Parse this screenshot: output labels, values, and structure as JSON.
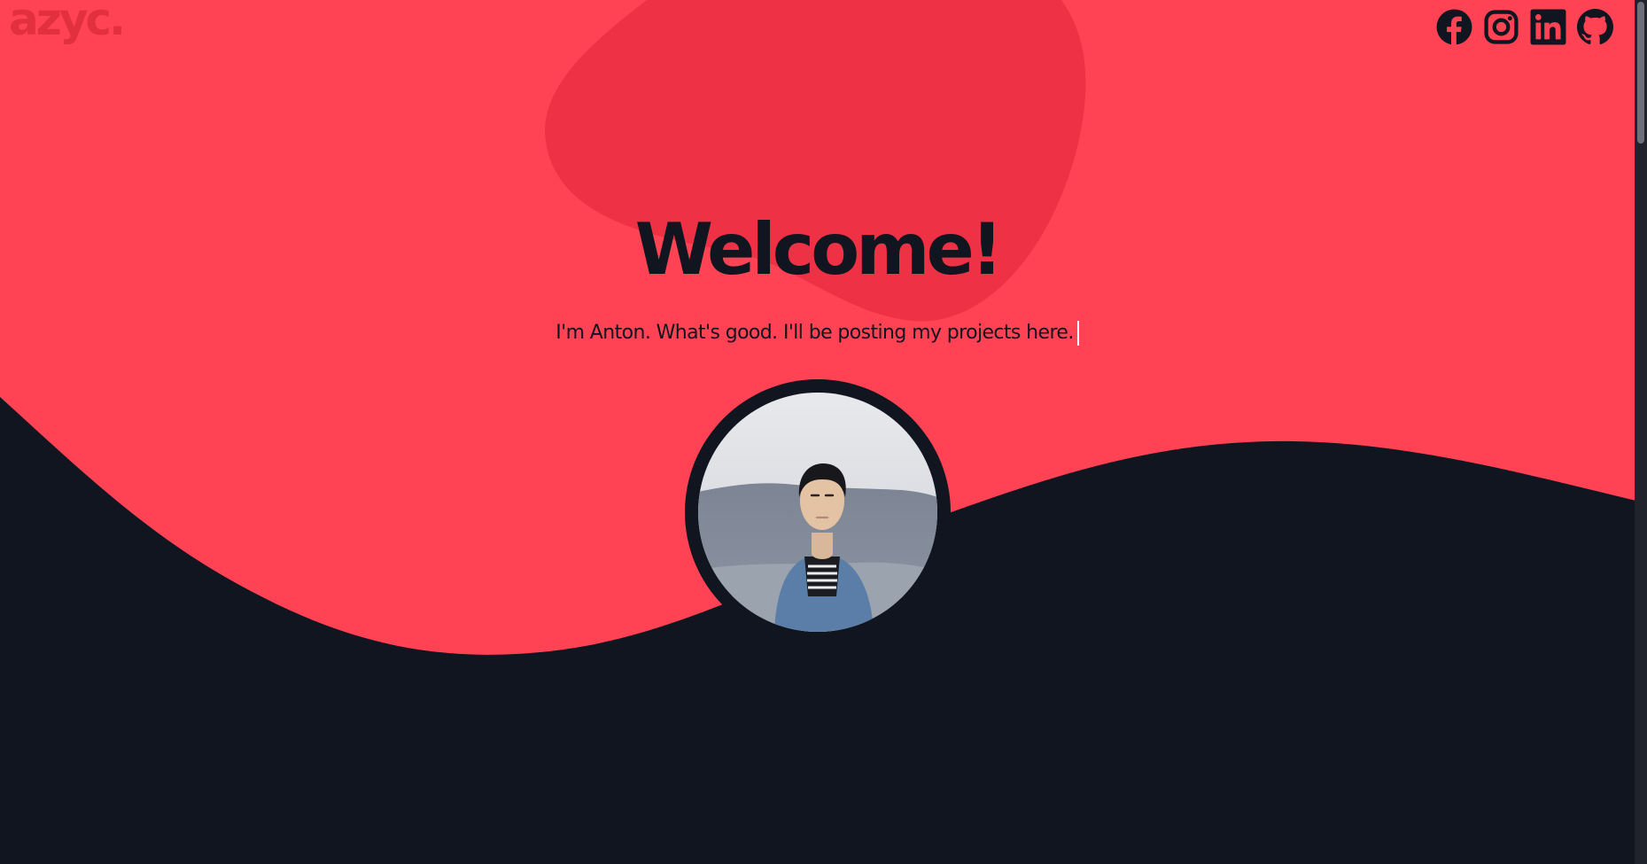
{
  "header": {
    "logo_text": "azyc.",
    "socials": [
      {
        "name": "Facebook",
        "icon": "facebook-icon"
      },
      {
        "name": "Instagram",
        "icon": "instagram-icon"
      },
      {
        "name": "LinkedIn",
        "icon": "linkedin-icon"
      },
      {
        "name": "GitHub",
        "icon": "github-icon"
      }
    ]
  },
  "hero": {
    "title": "Welcome!",
    "subtitle": "I'm Anton. What's good. I'll be posting my projects here."
  },
  "colors": {
    "primary": "#ff4354",
    "blob": "#ef3145",
    "dark": "#111520",
    "logo": "#e2303f"
  }
}
